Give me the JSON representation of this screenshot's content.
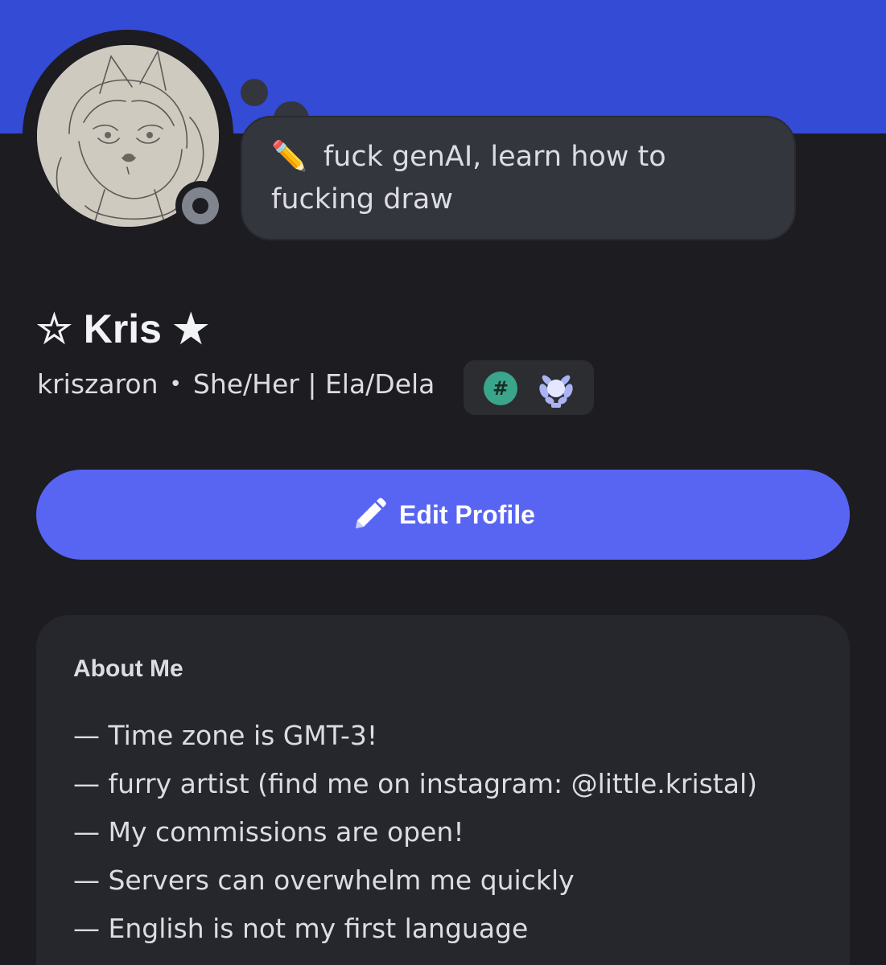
{
  "status_bubble": {
    "emoji": "✏️",
    "text": "fuck genAI, learn how to fucking draw"
  },
  "profile": {
    "display_name": "☆ Kris ★",
    "username": "kriszaron",
    "separator": "•",
    "pronouns": "She/Her | Ela/Dela",
    "presence": "offline",
    "badges": [
      {
        "icon": "hashtag-badge-icon",
        "symbol": "#",
        "color": "#3aa58a"
      },
      {
        "icon": "laurel-badge-icon",
        "color": "#aab4f5"
      }
    ]
  },
  "actions": {
    "edit_profile_label": "Edit Profile",
    "edit_icon": "pencil-icon"
  },
  "about": {
    "title": "About Me",
    "lines": [
      "— Time zone is GMT-3!",
      "— furry artist (find me on instagram: @little.kristal)",
      "— My commissions are open!",
      "— Servers can overwhelm me quickly",
      "— English is not my first language"
    ]
  },
  "colors": {
    "banner": "#344bd5",
    "background": "#1c1c21",
    "button": "#5865f2",
    "card": "#26272d"
  }
}
